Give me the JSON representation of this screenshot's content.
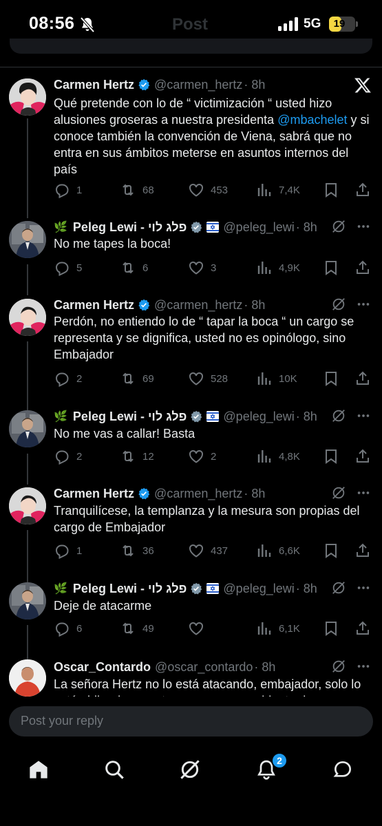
{
  "status": {
    "time": "08:56",
    "network": "5G",
    "battery": "19",
    "battery_level": 0.19
  },
  "header": {
    "title": "Post"
  },
  "tweets": [
    {
      "name": "Carmen Hertz",
      "handle": "@carmen_hertz",
      "time": "· 8h",
      "text_before": "Qué pretende con lo de “ victimización “ usted hizo alusiones groseras a nuestra presidenta ",
      "mention": "@mbachelet",
      "text_after": " y si conoce también la convención de Viena, sabrá que no entra en sus ámbitos meterse en asuntos internos del país",
      "replies": "1",
      "reposts": "68",
      "likes": "453",
      "views": "7,4K"
    },
    {
      "leaf": "🌿",
      "name": "Peleg Lewi - פלג לוי",
      "handle": "@peleg_lewi",
      "time": "· 8h",
      "text": "No me tapes la boca!",
      "replies": "5",
      "reposts": "6",
      "likes": "3",
      "views": "4,9K"
    },
    {
      "name": "Carmen Hertz",
      "handle": "@carmen_hertz",
      "time": "· 8h",
      "text": "Perdón, no entiendo lo de “ tapar la boca “ un cargo se representa y se dignifica, usted no es opinólogo, sino Embajador",
      "replies": "2",
      "reposts": "69",
      "likes": "528",
      "views": "10K"
    },
    {
      "leaf": "🌿",
      "name": "Peleg Lewi - פלג לוי",
      "handle": "@peleg_lewi",
      "time": "· 8h",
      "text": "No me vas a callar! Basta",
      "replies": "2",
      "reposts": "12",
      "likes": "2",
      "views": "4,8K"
    },
    {
      "name": "Carmen Hertz",
      "handle": "@carmen_hertz",
      "time": "· 8h",
      "text": "Tranquilícese, la templanza y la mesura son propias del cargo de Embajador",
      "replies": "1",
      "reposts": "36",
      "likes": "437",
      "views": "6,6K"
    },
    {
      "leaf": "🌿",
      "name": "Peleg Lewi - פלג לוי",
      "handle": "@peleg_lewi",
      "time": "· 8h",
      "text": "Deje de atacarme",
      "replies": "6",
      "reposts": "49",
      "views": "6,1K"
    },
    {
      "name": "Oscar_Contardo",
      "handle": "@oscar_contardo",
      "time": "· 8h",
      "text": "La señora Hertz no lo está atacando, embajador, solo lo está pidiendo respeto por una ex presidenta de"
    }
  ],
  "reply": {
    "placeholder": "Post your reply"
  },
  "tabbar": {
    "notifications_badge": "2"
  },
  "colors": {
    "accent": "#1d9bf0",
    "text": "#e7e9ea",
    "muted": "#71767b",
    "background": "#000000"
  }
}
